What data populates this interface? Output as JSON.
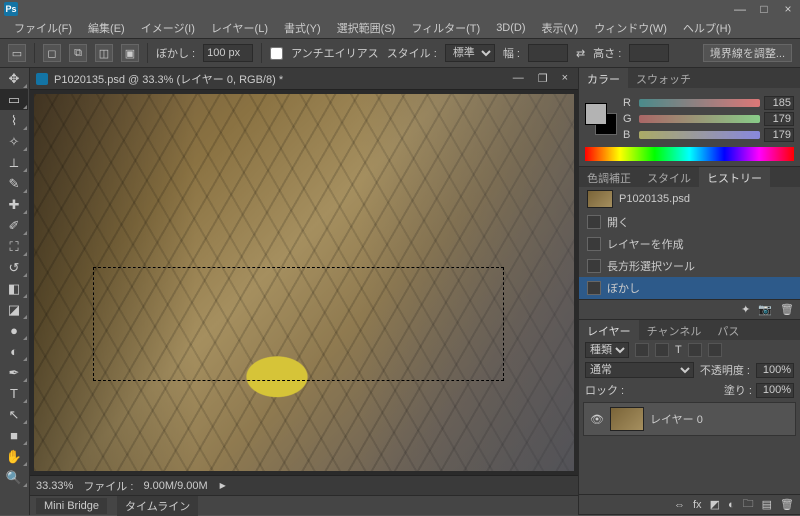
{
  "app": {
    "logo": "Ps"
  },
  "menu": [
    "ファイル(F)",
    "編集(E)",
    "イメージ(I)",
    "レイヤー(L)",
    "書式(Y)",
    "選択範囲(S)",
    "フィルター(T)",
    "3D(D)",
    "表示(V)",
    "ウィンドウ(W)",
    "ヘルプ(H)"
  ],
  "options": {
    "feather_label": "ぼかし :",
    "feather_value": "100 px",
    "antialias": "アンチエイリアス",
    "style_label": "スタイル :",
    "style_value": "標準",
    "width_label": "幅 :",
    "height_label": "高さ :",
    "refine": "境界線を調整..."
  },
  "document": {
    "title": "P1020135.psd @ 33.3% (レイヤー 0, RGB/8) *",
    "zoom": "33.33%",
    "file_label": "ファイル :",
    "file_size": "9.00M/9.00M"
  },
  "bottom_tabs": [
    "Mini Bridge",
    "タイムライン"
  ],
  "color_panel": {
    "tabs": [
      "カラー",
      "スウォッチ"
    ],
    "channels": [
      {
        "label": "R",
        "value": "185"
      },
      {
        "label": "G",
        "value": "179"
      },
      {
        "label": "B",
        "value": "179"
      }
    ]
  },
  "history_panel": {
    "tabs": [
      "色調補正",
      "スタイル",
      "ヒストリー"
    ],
    "snapshot": "P1020135.psd",
    "items": [
      "開く",
      "レイヤーを作成",
      "長方形選択ツール",
      "ぼかし"
    ]
  },
  "layers_panel": {
    "tabs": [
      "レイヤー",
      "チャンネル",
      "パス"
    ],
    "kind_label": "種類",
    "blend_mode": "通常",
    "opacity_label": "不透明度 :",
    "opacity_value": "100%",
    "lock_label": "ロック :",
    "fill_label": "塗り :",
    "fill_value": "100%",
    "layer_name": "レイヤー 0"
  }
}
